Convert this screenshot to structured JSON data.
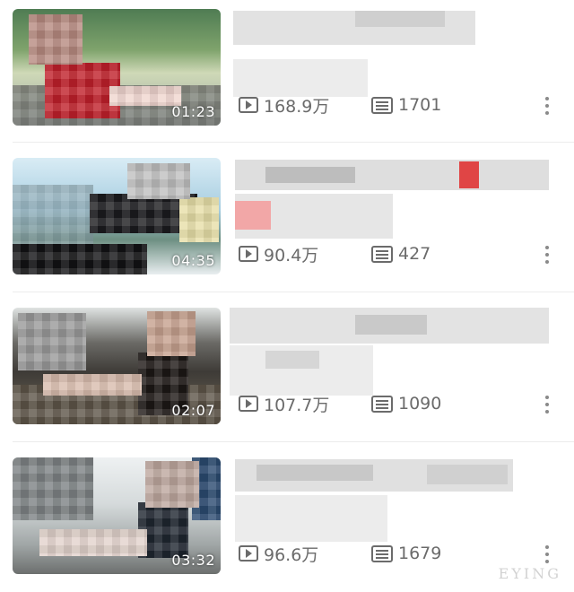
{
  "videos": [
    {
      "duration": "01:23",
      "views": "168.9万",
      "comments": "1701"
    },
    {
      "duration": "04:35",
      "views": "90.4万",
      "comments": "427"
    },
    {
      "duration": "02:07",
      "views": "107.7万",
      "comments": "1090"
    },
    {
      "duration": "03:32",
      "views": "96.6万",
      "comments": "1679"
    }
  ],
  "icons": {
    "views": "play-icon",
    "comments": "danmu-icon",
    "more": "more-vertical-icon"
  },
  "watermark": "EYING",
  "colors": {
    "stat_text": "#6b6b6b",
    "divider": "#ececec",
    "mosaic_red": "#e04545"
  }
}
